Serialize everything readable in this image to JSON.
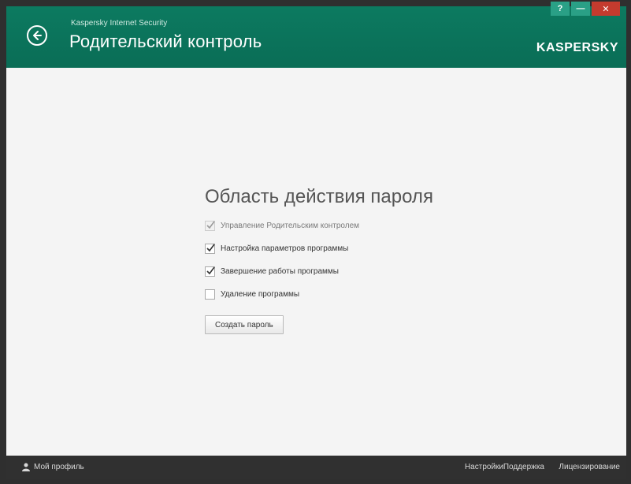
{
  "header": {
    "app_name": "Kaspersky Internet Security",
    "title": "Родительский контроль",
    "brand": "KASPERSKY",
    "window_controls": {
      "help": "?",
      "minimize": "—",
      "close": "✕"
    }
  },
  "main": {
    "section_title": "Область действия пароля",
    "options": [
      {
        "label": "Управление Родительским контролем",
        "checked": true,
        "disabled": true
      },
      {
        "label": "Настройка параметров программы",
        "checked": true,
        "disabled": false
      },
      {
        "label": "Завершение работы программы",
        "checked": true,
        "disabled": false
      },
      {
        "label": "Удаление программы",
        "checked": false,
        "disabled": false
      }
    ],
    "create_button": "Создать пароль"
  },
  "footer": {
    "profile": "Мой профиль",
    "settings": "Настройки",
    "support": "Поддержка",
    "licensing": "Лицензирование"
  },
  "colors": {
    "header": "#0c7a60",
    "footer": "#303030",
    "close": "#c43b2e"
  }
}
